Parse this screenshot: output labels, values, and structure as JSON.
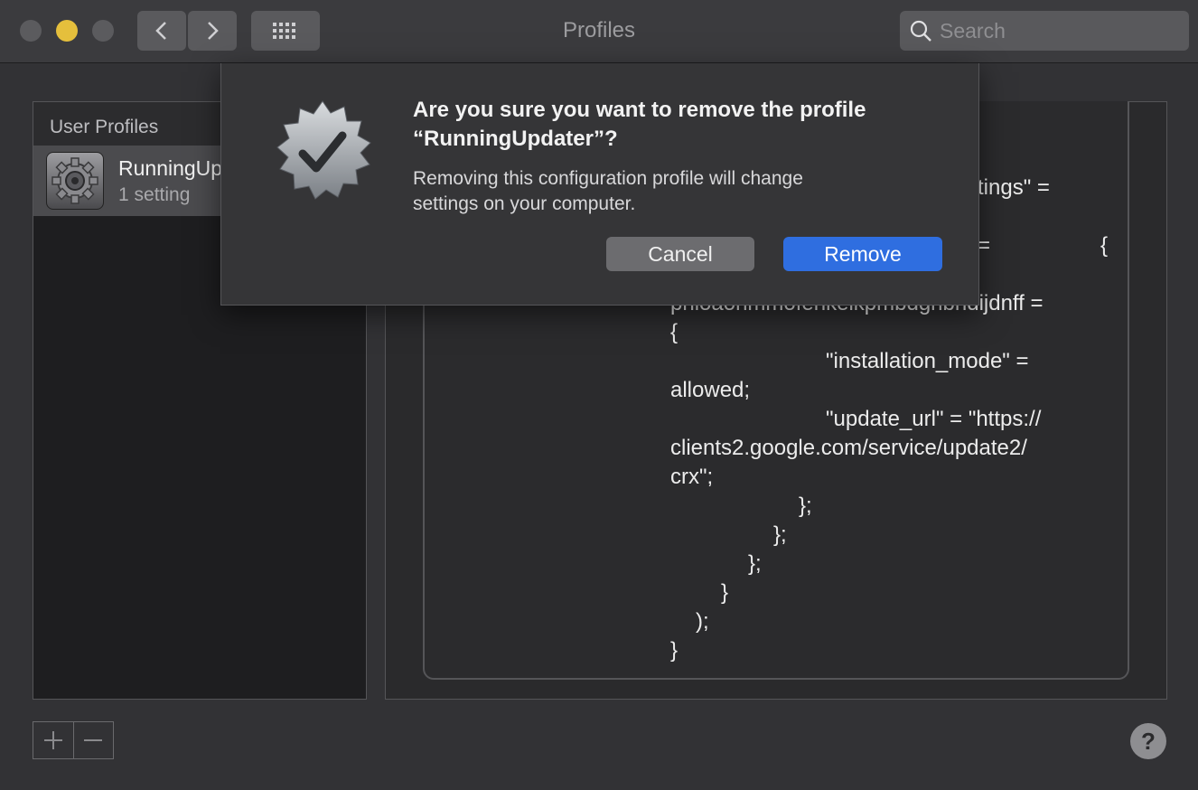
{
  "window": {
    "title": "Profiles"
  },
  "toolbar": {
    "back_icon": "chevron-left-icon",
    "forward_icon": "chevron-right-icon",
    "grid_icon": "grid-icon",
    "search_placeholder": "Search"
  },
  "sidebar": {
    "header": "User Profiles",
    "profiles": [
      {
        "name": "RunningUp",
        "subtitle": "1 setting",
        "icon": "gear-icon"
      }
    ]
  },
  "settings_code": {
    "lines": [
      "tings\" =",
      "=",
      "{",
      "phloaohmmofehkeikpmbdgnbndijdnff =",
      "{",
      "\"installation_mode\" =",
      "allowed;",
      "\"update_url\" = \"https://",
      "clients2.google.com/service/update2/",
      "crx\";",
      "};",
      "};",
      "};",
      "}",
      ");",
      "}"
    ]
  },
  "dialog": {
    "title_line1": "Are you sure you want to remove the profile",
    "title_line2": "“RunningUpdater”?",
    "message_line1": "Removing this configuration profile will change",
    "message_line2": "settings on your computer.",
    "cancel_label": "Cancel",
    "remove_label": "Remove",
    "icon": "verified-badge-icon"
  },
  "bottom": {
    "add_label": "+",
    "remove_label": "−",
    "help_label": "?"
  },
  "colors": {
    "accent": "#2f6ee0",
    "minimize": "#e5bf3c"
  }
}
